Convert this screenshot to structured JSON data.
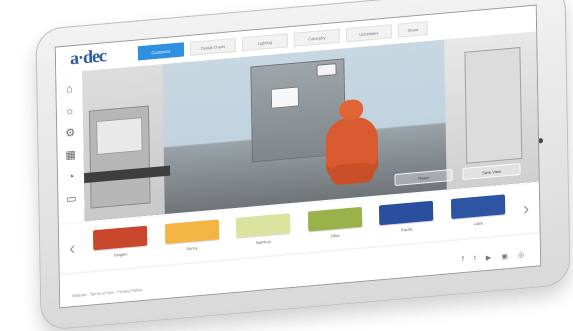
{
  "brand": {
    "logo_text": "a·dec"
  },
  "nav": {
    "tabs": [
      {
        "label": "Customize"
      },
      {
        "label": "Dental Chairs"
      },
      {
        "label": "Lighting"
      },
      {
        "label": "Cabinetry"
      },
      {
        "label": "Upholstery"
      },
      {
        "label": "Share"
      }
    ]
  },
  "sidebar": {
    "items": [
      {
        "icon": "chair-icon"
      },
      {
        "icon": "light-icon"
      },
      {
        "icon": "delivery-icon"
      },
      {
        "icon": "cabinet-icon"
      },
      {
        "icon": "sink-icon"
      },
      {
        "icon": "monitor-icon"
      }
    ]
  },
  "scene": {
    "controls": [
      {
        "label": "Reset"
      },
      {
        "label": "Save View"
      }
    ]
  },
  "swatches": [
    {
      "name": "Tangelo",
      "color": "#c9472c"
    },
    {
      "name": "Sunny",
      "color": "#f2b544"
    },
    {
      "name": "Bamboo",
      "color": "#dbe3a0"
    },
    {
      "name": "Olive",
      "color": "#9ab24a"
    },
    {
      "name": "Pacific",
      "color": "#2b4f9f"
    },
    {
      "name": "Lapis",
      "color": "#2e55a3"
    }
  ],
  "footer": {
    "links": "Website  ·  Terms of Use  ·  Privacy Policy",
    "social": [
      "f",
      "t",
      "▶",
      "▣",
      "◎"
    ]
  }
}
